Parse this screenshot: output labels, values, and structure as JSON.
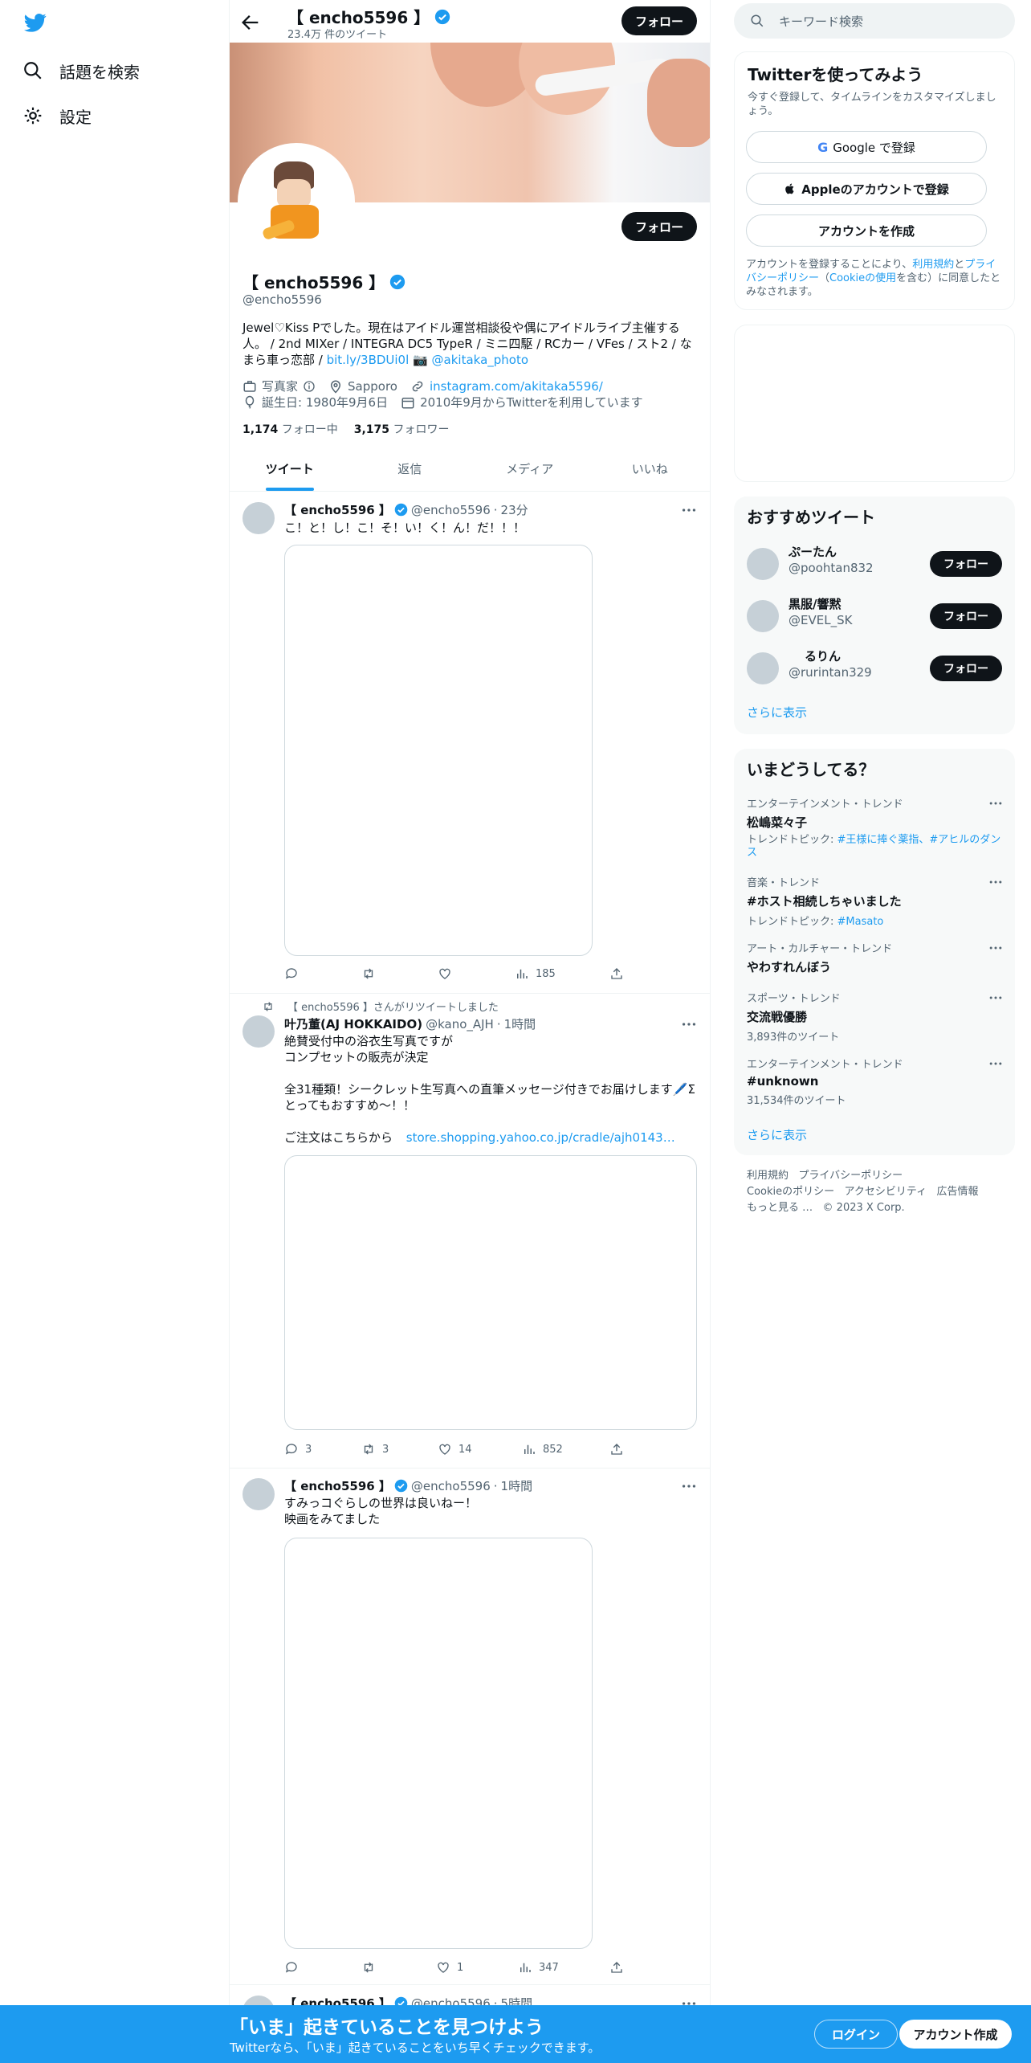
{
  "colors": {
    "accent": "#1d9bf0",
    "dark": "#0f1419",
    "muted": "#536471",
    "verified": "#1d9bf0",
    "banner_bar": "#1d9bf0"
  },
  "nav": {
    "explore": "話題を検索",
    "settings": "設定"
  },
  "header": {
    "name": "【 encho5596 】",
    "tweet_count": "23.4万 件のツイート",
    "follow": "フォロー"
  },
  "profile": {
    "name": "【 encho5596 】",
    "handle": "@encho5596",
    "follow": "フォロー",
    "bio_text": "Jewel♡Kiss Pでした。現在はアイドル運営相談役や偶にアイドルライブ主催する人。 / 2nd MIXer / INTEGRA DC5 TypeR / ミニ四駆 / RCカー / VFes / スト2 / なまら車っ恋部 / ",
    "bio_link": "bit.ly/3BDUi0l",
    "bio_camera": "📷",
    "bio_mention": "@akitaka_photo",
    "category": "写真家",
    "location": "Sapporo",
    "website": "instagram.com/akitaka5596/",
    "birthday": "誕生日: 1980年9月6日",
    "joined": "2010年9月からTwitterを利用しています",
    "following_count": "1,174",
    "following_label": "フォロー中",
    "followers_count": "3,175",
    "followers_label": "フォロワー"
  },
  "tabs": [
    "ツイート",
    "返信",
    "メディア",
    "いいね"
  ],
  "tweets": [
    {
      "name": "【 encho5596 】",
      "handle": "@encho5596",
      "time": "23分",
      "text": "こ！と！し！こ！そ！い！く！ん！だ！！！",
      "reply": "",
      "retweet": "",
      "like": "",
      "views": "185"
    },
    {
      "retweet_label": "【 encho5596 】さんがリツイートしました",
      "name": "叶乃董(AJ HOKKAIDO)",
      "handle": "@kano_AJH",
      "time": "1時間",
      "line1": "絶賛受付中の浴衣生写真ですが",
      "line2": "コンプセットの販売が決定",
      "line3": "全31種類！シークレット生写真への直筆メッセージ付きでお届けします🖊️Σ",
      "line4": "とってもおすすめ〜！！",
      "line5": "ご注文はこちらから ",
      "link": "store.shopping.yahoo.co.jp/cradle/ajh0143…",
      "reply": "3",
      "retweet": "3",
      "like": "14",
      "views": "852"
    },
    {
      "name": "【 encho5596 】",
      "handle": "@encho5596",
      "time": "1時間",
      "line1": "すみっコぐらしの世界は良いねー！",
      "line2": "映画をみてました",
      "reply": "",
      "retweet": "",
      "like": "1",
      "views": "347"
    },
    {
      "name": "【 encho5596 】",
      "handle": "@encho5596",
      "time": "5時間"
    }
  ],
  "search": {
    "placeholder": "キーワード検索"
  },
  "signup": {
    "title": "Twitterを使ってみよう",
    "subtitle": "今すぐ登録して、タイムラインをカスタマイズしましょう。",
    "google": "Google で登録",
    "apple": "Appleのアカウントで登録",
    "create": "アカウントを作成",
    "terms_pre": "アカウントを登録することにより、",
    "terms_link": "利用規約",
    "terms_and": "と",
    "privacy_link": "プライバシーポリシー",
    "terms_mid": "（",
    "cookie_link": "Cookieの使用",
    "terms_post": "を含む）に同意したとみなされます。"
  },
  "recommend": {
    "title": "おすすめツイート",
    "more": "さらに表示",
    "follow": "フォロー",
    "users": [
      {
        "name": "ぷーたん",
        "handle": "@poohtan832"
      },
      {
        "name": "黒服/響黙",
        "handle": "@EVEL_SK"
      },
      {
        "name": "るりん",
        "handle": "@rurintan329"
      }
    ]
  },
  "trends": {
    "title": "いまどうしてる？",
    "more": "さらに表示",
    "items": [
      {
        "cat": "エンターテインメント・トレンド",
        "name": "松嶋菜々子",
        "sub_pre": "トレンドトピック: ",
        "sub_link": "#王様に捧ぐ薬指、#アヒルのダンス"
      },
      {
        "cat": "音楽・トレンド",
        "name": "#ホスト相続しちゃいました",
        "sub_pre": "トレンドトピック: ",
        "sub_link": "#Masato"
      },
      {
        "cat": "アート・カルチャー・トレンド",
        "name": "やわすれんぼう",
        "sub_pre": "",
        "sub_link": ""
      },
      {
        "cat": "スポーツ・トレンド",
        "name": "交流戦優勝",
        "sub_pre": "3,893件のツイート",
        "sub_link": ""
      },
      {
        "cat": "エンターテインメント・トレンド",
        "name": "#unknown",
        "sub_pre": "31,534件のツイート",
        "sub_link": ""
      }
    ]
  },
  "footer": {
    "terms": "利用規約",
    "privacy": "プライバシーポリシー",
    "cookie": "Cookieのポリシー",
    "access": "アクセシビリティ",
    "ads": "広告情報",
    "more": "もっと見る …",
    "copy": "© 2023 X Corp."
  },
  "bottom": {
    "title": "「いま」起きていることを見つけよう",
    "subtitle": "Twitterなら、「いま」起きていることをいち早くチェックできます。",
    "login": "ログイン",
    "signup": "アカウント作成"
  }
}
